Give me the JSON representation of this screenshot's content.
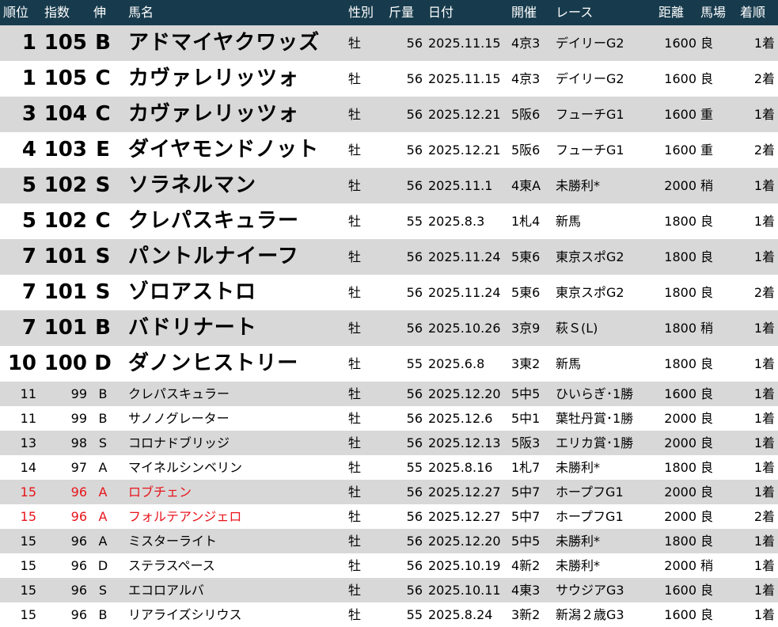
{
  "header": {
    "rank": "順位",
    "index": "指数",
    "grade": "伸",
    "name": "馬名",
    "sex": "性別",
    "weight": "斤量",
    "date": "日付",
    "meet": "開催",
    "race": "レース",
    "distance": "距離",
    "track": "馬場",
    "place": "着順"
  },
  "colors": {
    "header_bg": "#173b4d",
    "header_text": "#ffffff",
    "stripe": "#d8d8d8",
    "highlight_text": "#e8141b"
  },
  "rows": [
    {
      "rank": "1",
      "index": "105",
      "grade": "B",
      "name": "アドマイヤクワッズ",
      "sex": "牡",
      "weight": "56",
      "date": "2025.11.15",
      "meet": "4京3",
      "race": "デイリーG2",
      "distance": "1600",
      "track": "良",
      "place": "1着"
    },
    {
      "rank": "1",
      "index": "105",
      "grade": "C",
      "name": "カヴァレリッツォ",
      "sex": "牡",
      "weight": "56",
      "date": "2025.11.15",
      "meet": "4京3",
      "race": "デイリーG2",
      "distance": "1600",
      "track": "良",
      "place": "2着"
    },
    {
      "rank": "3",
      "index": "104",
      "grade": "C",
      "name": "カヴァレリッツォ",
      "sex": "牡",
      "weight": "56",
      "date": "2025.12.21",
      "meet": "5阪6",
      "race": "フューチG1",
      "distance": "1600",
      "track": "重",
      "place": "1着"
    },
    {
      "rank": "4",
      "index": "103",
      "grade": "E",
      "name": "ダイヤモンドノット",
      "sex": "牡",
      "weight": "56",
      "date": "2025.12.21",
      "meet": "5阪6",
      "race": "フューチG1",
      "distance": "1600",
      "track": "重",
      "place": "2着"
    },
    {
      "rank": "5",
      "index": "102",
      "grade": "S",
      "name": "ソラネルマン",
      "sex": "牡",
      "weight": "56",
      "date": "2025.11.1",
      "meet": "4東A",
      "race": "未勝利*",
      "distance": "2000",
      "track": "稍",
      "place": "1着"
    },
    {
      "rank": "5",
      "index": "102",
      "grade": "C",
      "name": "クレパスキュラー",
      "sex": "牡",
      "weight": "55",
      "date": "2025.8.3",
      "meet": "1札4",
      "race": "新馬",
      "distance": "1800",
      "track": "良",
      "place": "1着"
    },
    {
      "rank": "7",
      "index": "101",
      "grade": "S",
      "name": "パントルナイーフ",
      "sex": "牡",
      "weight": "56",
      "date": "2025.11.24",
      "meet": "5東6",
      "race": "東京スポG2",
      "distance": "1800",
      "track": "良",
      "place": "1着"
    },
    {
      "rank": "7",
      "index": "101",
      "grade": "S",
      "name": "ゾロアストロ",
      "sex": "牡",
      "weight": "56",
      "date": "2025.11.24",
      "meet": "5東6",
      "race": "東京スポG2",
      "distance": "1800",
      "track": "良",
      "place": "2着"
    },
    {
      "rank": "7",
      "index": "101",
      "grade": "B",
      "name": "バドリナート",
      "sex": "牡",
      "weight": "56",
      "date": "2025.10.26",
      "meet": "3京9",
      "race": "萩Ｓ(L)",
      "distance": "1800",
      "track": "稍",
      "place": "1着"
    },
    {
      "rank": "10",
      "index": "100",
      "grade": "D",
      "name": "ダノンヒストリー",
      "sex": "牡",
      "weight": "55",
      "date": "2025.6.8",
      "meet": "3東2",
      "race": "新馬",
      "distance": "1800",
      "track": "良",
      "place": "1着"
    },
    {
      "rank": "11",
      "index": "99",
      "grade": "B",
      "name": "クレパスキュラー",
      "sex": "牡",
      "weight": "56",
      "date": "2025.12.20",
      "meet": "5中5",
      "race": "ひいらぎ･1勝",
      "distance": "1600",
      "track": "良",
      "place": "1着"
    },
    {
      "rank": "11",
      "index": "99",
      "grade": "B",
      "name": "サノノグレーター",
      "sex": "牡",
      "weight": "56",
      "date": "2025.12.6",
      "meet": "5中1",
      "race": "葉牡丹賞･1勝",
      "distance": "2000",
      "track": "良",
      "place": "1着"
    },
    {
      "rank": "13",
      "index": "98",
      "grade": "S",
      "name": "コロナドブリッジ",
      "sex": "牡",
      "weight": "56",
      "date": "2025.12.13",
      "meet": "5阪3",
      "race": "エリカ賞･1勝",
      "distance": "2000",
      "track": "良",
      "place": "1着"
    },
    {
      "rank": "14",
      "index": "97",
      "grade": "A",
      "name": "マイネルシンベリン",
      "sex": "牡",
      "weight": "55",
      "date": "2025.8.16",
      "meet": "1札7",
      "race": "未勝利*",
      "distance": "1800",
      "track": "良",
      "place": "1着"
    },
    {
      "rank": "15",
      "index": "96",
      "grade": "A",
      "name": "ロブチェン",
      "sex": "牡",
      "weight": "56",
      "date": "2025.12.27",
      "meet": "5中7",
      "race": "ホープフG1",
      "distance": "2000",
      "track": "良",
      "place": "1着",
      "highlight": true
    },
    {
      "rank": "15",
      "index": "96",
      "grade": "A",
      "name": "フォルテアンジェロ",
      "sex": "牡",
      "weight": "56",
      "date": "2025.12.27",
      "meet": "5中7",
      "race": "ホープフG1",
      "distance": "2000",
      "track": "良",
      "place": "2着",
      "highlight": true
    },
    {
      "rank": "15",
      "index": "96",
      "grade": "A",
      "name": "ミスターライト",
      "sex": "牡",
      "weight": "56",
      "date": "2025.12.20",
      "meet": "5中5",
      "race": "未勝利*",
      "distance": "1800",
      "track": "良",
      "place": "1着"
    },
    {
      "rank": "15",
      "index": "96",
      "grade": "D",
      "name": "ステラスペース",
      "sex": "牡",
      "weight": "56",
      "date": "2025.10.19",
      "meet": "4新2",
      "race": "未勝利*",
      "distance": "2000",
      "track": "稍",
      "place": "1着"
    },
    {
      "rank": "15",
      "index": "96",
      "grade": "S",
      "name": "エコロアルバ",
      "sex": "牡",
      "weight": "56",
      "date": "2025.10.11",
      "meet": "4東3",
      "race": "サウジアG3",
      "distance": "1600",
      "track": "良",
      "place": "1着"
    },
    {
      "rank": "15",
      "index": "96",
      "grade": "B",
      "name": "リアライズシリウス",
      "sex": "牡",
      "weight": "55",
      "date": "2025.8.24",
      "meet": "3新2",
      "race": "新潟２歳G3",
      "distance": "1600",
      "track": "良",
      "place": "1着"
    }
  ]
}
